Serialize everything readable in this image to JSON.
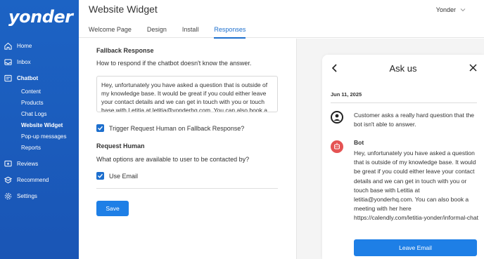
{
  "app": {
    "logo": "yonder"
  },
  "sidebar": {
    "items": [
      {
        "label": "Home",
        "icon": "home-icon"
      },
      {
        "label": "Inbox",
        "icon": "inbox-icon"
      },
      {
        "label": "Chatbot",
        "icon": "chatbot-icon"
      },
      {
        "label": "Reviews",
        "icon": "reviews-icon"
      },
      {
        "label": "Recommend",
        "icon": "recommend-icon"
      },
      {
        "label": "Settings",
        "icon": "gear-icon"
      }
    ],
    "chatbot_sub": [
      "Content",
      "Products",
      "Chat Logs",
      "Website Widget",
      "Pop-up messages",
      "Reports"
    ],
    "active_sub": "Website Widget"
  },
  "header": {
    "title": "Website Widget",
    "account": "Yonder",
    "tabs": [
      "Welcome Page",
      "Design",
      "Install",
      "Responses"
    ],
    "active_tab": "Responses"
  },
  "form": {
    "fallback_title": "Fallback Response",
    "fallback_desc": "How to respond if the chatbot doesn't know the answer.",
    "fallback_text": "Hey, unfortunately you have asked a question that is outside of my knowledge base.  It would be great if you could either leave your contact details and we can get in touch with you or touch base with Letitia at letitia@yonderhq.com. You can also book a",
    "trigger_label": "Trigger Request Human on Fallback Response?",
    "request_title": "Request Human",
    "request_desc": "What options are available to user to be contacted by?",
    "use_email_label": "Use Email",
    "save_label": "Save"
  },
  "preview": {
    "title": "Ask us",
    "date": "Jun 11, 2025",
    "user_message": "Customer asks a really hard question that the bot isn't able to answer.",
    "bot_name": "Bot",
    "bot_message": "Hey, unfortunately you have asked a question that is outside of my knowledge base.  It would be great if you could either leave your contact details and we can get in touch with you or touch base with Letitia at letitia@yonderhq.com. You can also book a meeting with her here https://calendly.com/letitia-yonder/informal-chat",
    "leave_email_label": "Leave Email"
  },
  "colors": {
    "sidebar": "#1c63c4",
    "accent": "#1e7fe6",
    "bot_avatar": "#e55353"
  }
}
